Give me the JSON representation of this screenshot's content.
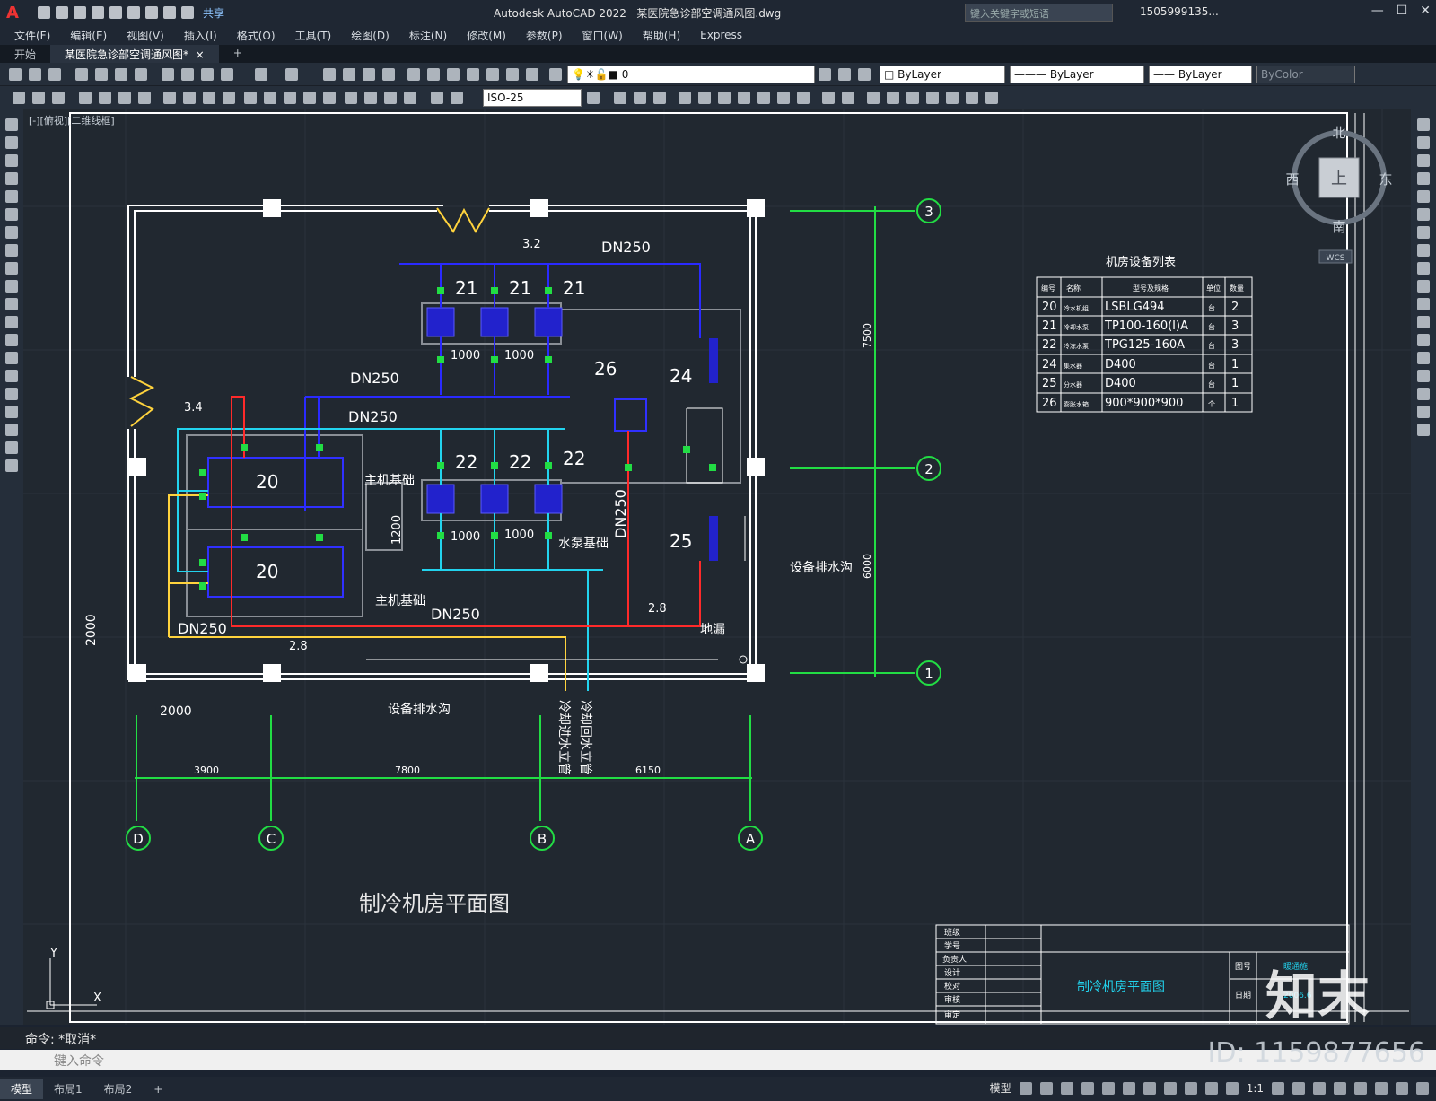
{
  "titlebar": {
    "app_title": "Autodesk AutoCAD 2022",
    "doc": "某医院急诊部空调通风图.dwg",
    "share": "共享",
    "search_placeholder": "键入关键字或短语",
    "user": "1505999135..."
  },
  "menu": [
    "文件(F)",
    "编辑(E)",
    "视图(V)",
    "插入(I)",
    "格式(O)",
    "工具(T)",
    "绘图(D)",
    "标注(N)",
    "修改(M)",
    "参数(P)",
    "窗口(W)",
    "帮助(H)",
    "Express"
  ],
  "tabs": {
    "start": "开始",
    "doc": "某医院急诊部空调通风图*",
    "close": "×",
    "add": "+"
  },
  "toolbar": {
    "layer": "0",
    "color": "ByLayer",
    "linetype": "ByLayer",
    "lineweight": "ByLayer",
    "plotstyle": "ByColor",
    "dimstyle": "ISO-25"
  },
  "viewport_label": "[-][俯视][二维线框]",
  "viewcube": {
    "north": "北",
    "south": "南",
    "west": "西",
    "east": "东",
    "top": "上",
    "wcs": "WCS"
  },
  "drawing": {
    "title": "制冷机房平面图",
    "labels": {
      "dn250_top": "DN250",
      "dn250_a": "DN250",
      "dn250_b": "DN250",
      "dn250_c": "DN250",
      "dn250_d": "DN250",
      "dn250_v": "DN250",
      "slope_32": "3.2",
      "slope_34": "3.4",
      "slope_28a": "2.8",
      "slope_28b": "2.8",
      "p21": "21",
      "p22": "22",
      "p26": "26",
      "p24": "24",
      "p25": "25",
      "p20": "20",
      "d1000": "1000",
      "d1200": "1200",
      "d2000": "2000",
      "main_base": "主机基础",
      "pump_base": "水泵基础",
      "drain_trench": "设备排水沟",
      "floor_drain": "地漏",
      "cold_in": "冷却进水立管",
      "cold_out": "冷却回水立管",
      "dim_3900": "3900",
      "dim_7800": "7800",
      "dim_6150": "6150",
      "dim_7500": "7500",
      "dim_6000": "6000"
    },
    "axes_h": [
      "D",
      "C",
      "B",
      "A"
    ],
    "axes_v": [
      "3",
      "2",
      "1"
    ],
    "table": {
      "title": "机房设备列表",
      "headers": [
        "编号",
        "名称",
        "型号及规格",
        "单位",
        "数量"
      ],
      "rows": [
        [
          "20",
          "冷水机组",
          "LSBLG494",
          "台",
          "2"
        ],
        [
          "21",
          "冷却水泵",
          "TP100-160(I)A",
          "台",
          "3"
        ],
        [
          "22",
          "冷冻水泵",
          "TPG125-160A",
          "台",
          "3"
        ],
        [
          "24",
          "集水器",
          "D400",
          "台",
          "1"
        ],
        [
          "25",
          "分水器",
          "D400",
          "台",
          "1"
        ],
        [
          "26",
          "膨胀水箱",
          "900*900*900",
          "个",
          "1"
        ]
      ]
    },
    "titleblock": {
      "rows": [
        "班级",
        "学号",
        "负责人",
        "设计",
        "校对",
        "审核",
        "审定"
      ],
      "name": "制冷机房平面图",
      "r1": "图号",
      "r2": "日期",
      "v1": "暖通施",
      "v2": "2006.6"
    }
  },
  "ucs": {
    "y": "Y",
    "x": "X"
  },
  "watermark": "知末",
  "image_id": "ID: 1159877656",
  "command": {
    "line": "命令: *取消*",
    "placeholder": "键入命令"
  },
  "status": {
    "tabs": [
      "模型",
      "布局1",
      "布局2",
      "+"
    ],
    "model": "模型",
    "scale": "1:1"
  }
}
